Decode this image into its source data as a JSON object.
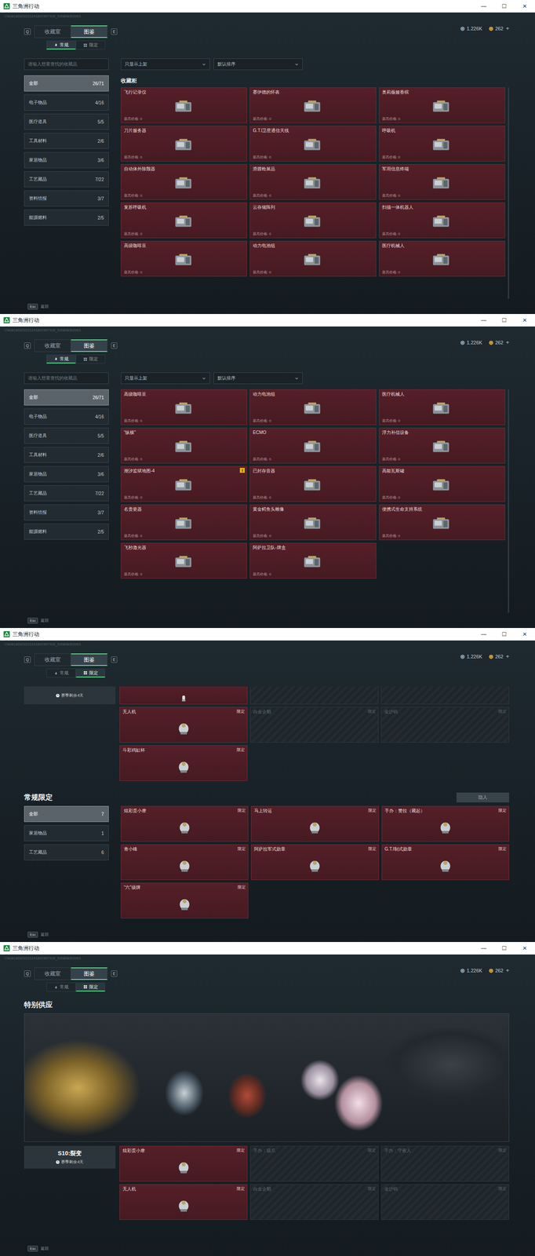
{
  "window": {
    "title": "三角洲行动",
    "controls": [
      "—",
      "☐",
      "✕"
    ]
  },
  "header": {
    "build_id": "CN08180929212241801597326_200808302001",
    "nav_keys": [
      "Q",
      "E"
    ],
    "top_tabs": [
      {
        "label": "收藏室",
        "selected": false
      },
      {
        "label": "图鉴",
        "selected": true
      }
    ],
    "currency": [
      {
        "kind": "silver",
        "value": "1.226K"
      },
      {
        "kind": "gold",
        "value": "262"
      }
    ],
    "currency_add": "+"
  },
  "footer": {
    "key": "Esc",
    "label": "返回"
  },
  "panels": [
    {
      "kind": "regular",
      "sub_tabs": [
        {
          "label": "常规",
          "kind": "regular",
          "selected": true
        },
        {
          "label": "限定",
          "kind": "limited",
          "selected": false
        }
      ],
      "search": {
        "placeholder": "请输入想要查找的收藏品"
      },
      "filters": [
        {
          "label": "只显示上架"
        },
        {
          "label": "默认排序"
        }
      ],
      "categories": [
        {
          "label": "全部",
          "count": "26/71",
          "selected": true
        },
        {
          "label": "电子物品",
          "count": "4/16",
          "selected": false
        },
        {
          "label": "医疗道具",
          "count": "5/5",
          "selected": false
        },
        {
          "label": "工具材料",
          "count": "2/6",
          "selected": false
        },
        {
          "label": "家居物品",
          "count": "3/6",
          "selected": false
        },
        {
          "label": "工艺藏品",
          "count": "7/22",
          "selected": false
        },
        {
          "label": "资料情报",
          "count": "3/7",
          "selected": false
        },
        {
          "label": "能源燃料",
          "count": "2/5",
          "selected": false
        }
      ],
      "section_title": "收藏柜",
      "items": [
        {
          "name": "飞行记录仪",
          "price": "最高价格: 0",
          "locked": false
        },
        {
          "name": "赛伊德的怀表",
          "price": "最高价格: 0",
          "locked": false
        },
        {
          "name": "奥莉薇娅香槟",
          "price": "最高价格: 0",
          "locked": false
        },
        {
          "name": "刀片服务器",
          "price": "最高价格: 0",
          "locked": false
        },
        {
          "name": "G.T.I卫星通信天线",
          "price": "最高价格: 0",
          "locked": false
        },
        {
          "name": "呼吸机",
          "price": "最高价格: 0",
          "locked": false
        },
        {
          "name": "自动体外除颤器",
          "price": "最高价格: 0",
          "locked": false
        },
        {
          "name": "滑膛枪展品",
          "price": "最高价格: 0",
          "locked": false
        },
        {
          "name": "军用信息终端",
          "price": "最高价格: 0",
          "locked": false
        },
        {
          "name": "复苏呼吸机",
          "price": "最高价格: 0",
          "locked": false
        },
        {
          "name": "云存储阵列",
          "price": "最高价格: 0",
          "locked": false
        },
        {
          "name": "扫描一体机器人",
          "price": "最高价格: 0",
          "locked": false
        },
        {
          "name": "高级咖啡豆",
          "price": "最高价格: 0",
          "locked": false
        },
        {
          "name": "动力电池组",
          "price": "最高价格: 0",
          "locked": false
        },
        {
          "name": "医疗机械人",
          "price": "最高价格: 0",
          "locked": false
        }
      ]
    },
    {
      "kind": "regular",
      "sub_tabs": [
        {
          "label": "常规",
          "kind": "regular",
          "selected": true
        },
        {
          "label": "限定",
          "kind": "limited",
          "selected": false
        }
      ],
      "search": {
        "placeholder": "请输入想要查找的收藏品"
      },
      "filters": [
        {
          "label": "只显示上架"
        },
        {
          "label": "默认排序"
        }
      ],
      "categories": [
        {
          "label": "全部",
          "count": "26/71",
          "selected": true
        },
        {
          "label": "电子物品",
          "count": "4/16",
          "selected": false
        },
        {
          "label": "医疗道具",
          "count": "5/5",
          "selected": false
        },
        {
          "label": "工具材料",
          "count": "2/6",
          "selected": false
        },
        {
          "label": "家居物品",
          "count": "3/6",
          "selected": false
        },
        {
          "label": "工艺藏品",
          "count": "7/22",
          "selected": false
        },
        {
          "label": "资料情报",
          "count": "3/7",
          "selected": false
        },
        {
          "label": "能源燃料",
          "count": "2/5",
          "selected": false
        }
      ],
      "items": [
        {
          "name": "高级咖啡豆",
          "price": "最高价格: 0",
          "locked": false
        },
        {
          "name": "动力电池组",
          "price": "最高价格: 0",
          "locked": false
        },
        {
          "name": "医疗机械人",
          "price": "最高价格: 0",
          "locked": false
        },
        {
          "name": "“纵横”",
          "price": "最高价格: 0",
          "locked": false
        },
        {
          "name": "ECMO",
          "price": "最高价格: 0",
          "locked": false
        },
        {
          "name": "浮力补偿设备",
          "price": "最高价格: 0",
          "locked": false
        },
        {
          "name": "潮汐监狱地图-4",
          "price": "最高价格: 0",
          "locked": false,
          "badge": "!"
        },
        {
          "name": "已封存音器",
          "price": "最高价格: 0",
          "locked": false
        },
        {
          "name": "高能瓦斯罐",
          "price": "最高价格: 0",
          "locked": false
        },
        {
          "name": "名贵瓷器",
          "price": "最高价格: 0",
          "locked": false
        },
        {
          "name": "黄金鳄鱼头雕像",
          "price": "最高价格: 0",
          "locked": false
        },
        {
          "name": "便携式生命支持系统",
          "price": "最高价格: 0",
          "locked": false
        },
        {
          "name": "飞秒激光器",
          "price": "最高价格: 0",
          "locked": false
        },
        {
          "name": "阿萨拉卫队-牌盒",
          "price": "最高价格: 0",
          "locked": false
        }
      ]
    },
    {
      "kind": "limited",
      "sub_tabs": [
        {
          "label": "常规",
          "kind": "regular",
          "selected": false
        },
        {
          "label": "限定",
          "kind": "limited",
          "selected": true
        }
      ],
      "sections": [
        {
          "kind": "season",
          "season": {
            "remaining": "赛季剩余4天"
          },
          "partial_row": [
            {
              "locked": false
            },
            {
              "locked": true
            },
            {
              "locked": true
            }
          ],
          "items": [
            {
              "name": "无人机",
              "tag": "限定",
              "locked": false
            },
            {
              "name": "白金企鹅",
              "tag": "限定",
              "locked": true
            },
            {
              "name": "金沙钨",
              "tag": "限定",
              "locked": true
            },
            {
              "name": "斗彩鸡缸杯",
              "tag": "限定",
              "locked": false
            }
          ]
        },
        {
          "kind": "category",
          "title": "常规限定",
          "button": "隐入",
          "categories": [
            {
              "label": "全部",
              "count": "7",
              "selected": true
            },
            {
              "label": "家居物品",
              "count": "1",
              "selected": false
            },
            {
              "label": "工艺藏品",
              "count": "6",
              "selected": false
            }
          ],
          "items": [
            {
              "name": "炫彩蛋小摩",
              "tag": "限定",
              "locked": false
            },
            {
              "name": "马上转运",
              "tag": "限定",
              "locked": false
            },
            {
              "name": "手办：赞拉（藏起）",
              "tag": "限定",
              "locked": false
            },
            {
              "name": "青小锋",
              "tag": "限定",
              "locked": false
            },
            {
              "name": "阿萨拉军式勋章",
              "tag": "限定",
              "locked": false
            },
            {
              "name": "G.T.I制式勋章",
              "tag": "限定",
              "locked": false
            },
            {
              "name": "“六”级牌",
              "tag": "限定",
              "locked": false
            }
          ]
        }
      ]
    },
    {
      "kind": "limited",
      "sub_tabs": [
        {
          "label": "常规",
          "kind": "regular",
          "selected": false
        },
        {
          "label": "限定",
          "kind": "limited",
          "selected": true
        }
      ],
      "sections": [
        {
          "kind": "season",
          "title": "特别供应",
          "banner": true,
          "season": {
            "name": "S10:裂变",
            "remaining": "赛季剩余4天"
          },
          "items": [
            {
              "name": "炫彩蛋小摩",
              "tag": "限定",
              "locked": false
            },
            {
              "name": "手办：骇爪",
              "tag": "限定",
              "locked": true
            },
            {
              "name": "手办：守夜人",
              "tag": "限定",
              "locked": true
            },
            {
              "name": "无人机",
              "tag": "限定",
              "locked": false
            },
            {
              "name": "白金企鹅",
              "tag": "限定",
              "locked": true
            },
            {
              "name": "金沙钨",
              "tag": "限定",
              "locked": true
            }
          ]
        }
      ]
    }
  ]
}
